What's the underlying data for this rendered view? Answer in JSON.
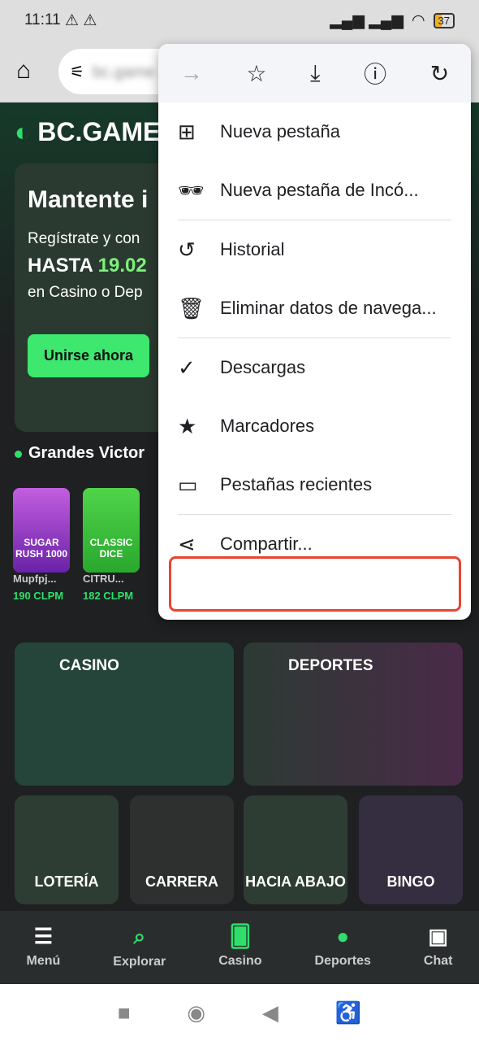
{
  "status": {
    "time": "11:11",
    "battery": "37"
  },
  "browser": {
    "url": "bc.game"
  },
  "page": {
    "logo": "BC.GAME",
    "hero": {
      "title": "Mantente i",
      "line1": "Regístrate y con",
      "line2a": "HASTA",
      "line2b": "19.02",
      "line3": "en Casino o Dep",
      "cta": "Unirse ahora"
    },
    "wins_title": "Grandes Victor",
    "games": [
      {
        "name": "Mupfpj...",
        "value": "190 CLPM",
        "art": "SUGAR RUSH 1000"
      },
      {
        "name": "CITRU...",
        "value": "182 CLPM",
        "art": "CLASSIC DICE"
      }
    ],
    "tiles": {
      "casino": "CASINO",
      "deportes": "DEPORTES",
      "loteria": "LOTERÍA",
      "carrera": "CARRERA",
      "hacia_abajo": "HACIA ABAJO",
      "bingo": "BINGO"
    }
  },
  "menu": {
    "items": [
      "Nueva pestaña",
      "Nueva pestaña de Incó...",
      "Historial",
      "Eliminar datos de navega...",
      "Descargas",
      "Marcadores",
      "Pestañas recientes",
      "Compartir..."
    ],
    "highlight_color": "#e8452f"
  },
  "bottom_nav": [
    "Menú",
    "Explorar",
    "Casino",
    "Deportes",
    "Chat"
  ]
}
